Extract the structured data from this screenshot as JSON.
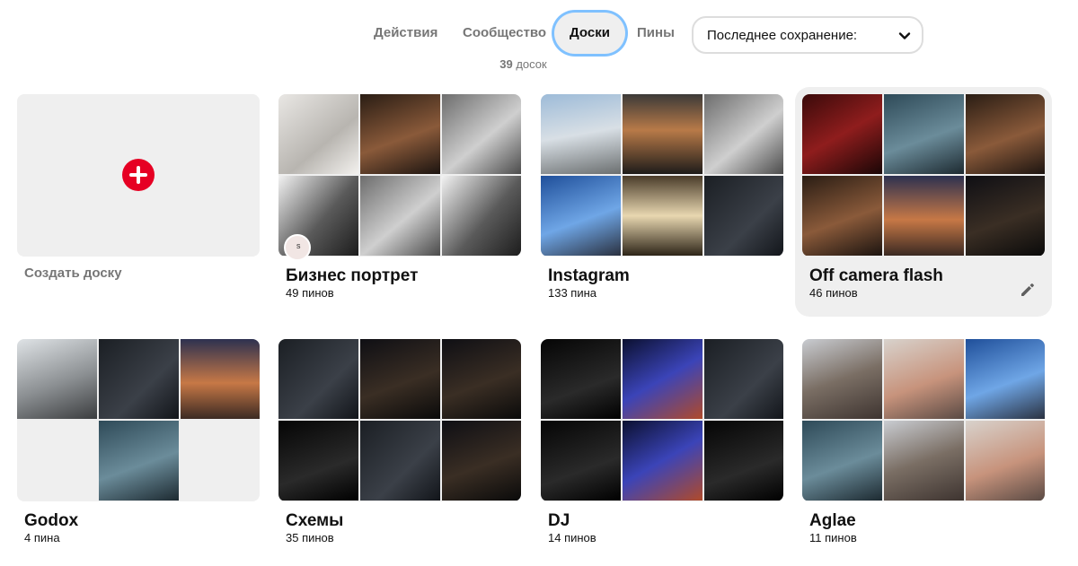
{
  "tabs": [
    {
      "label": "Действия",
      "active": false
    },
    {
      "label": "Сообщество",
      "active": false
    },
    {
      "label": "Доски",
      "active": true
    },
    {
      "label": "Пины",
      "active": false
    }
  ],
  "sort": {
    "label": "Последнее сохранение:",
    "icon": "chevron-down-icon"
  },
  "board_count": {
    "number": "39",
    "unit": "досок"
  },
  "create_board": {
    "label": "Создать доску",
    "icon": "plus-icon",
    "accent_color": "#e60023"
  },
  "boards": [
    {
      "title": "Бизнес портрет",
      "pins": "49 пинов",
      "collaborator_initial": "s"
    },
    {
      "title": "Instagram",
      "pins": "133 пина"
    },
    {
      "title": "Off camera flash",
      "pins": "46 пинов",
      "hovered": true,
      "edit_icon": "pencil-icon"
    },
    {
      "title": "Godox",
      "pins": "4 пина"
    },
    {
      "title": "Схемы",
      "pins": "35 пинов"
    },
    {
      "title": "DJ",
      "pins": "14 пинов"
    },
    {
      "title": "Aglae",
      "pins": "11 пинов"
    }
  ],
  "colors": {
    "active_ring": "#0084ff",
    "muted_text": "#767676",
    "card_bg": "#efefef"
  }
}
